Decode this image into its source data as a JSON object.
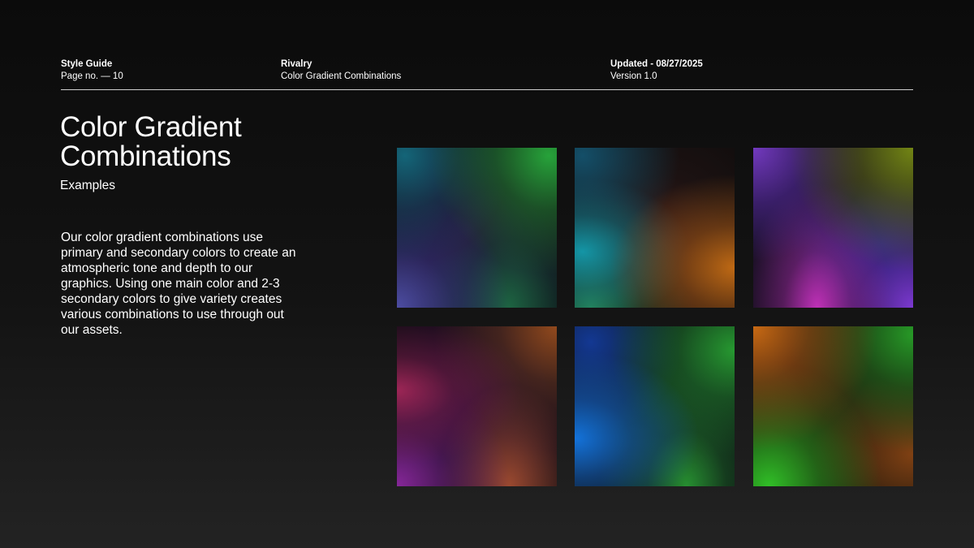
{
  "header": {
    "col1": {
      "title": "Style Guide",
      "sub": "Page no. — 10"
    },
    "col2": {
      "title": "Rivalry",
      "sub": "Color Gradient Combinations"
    },
    "col3": {
      "title": "Updated - 08/27/2025",
      "sub": "Version 1.0"
    }
  },
  "main": {
    "title": "Color Gradient Combinations",
    "subtitle": "Examples",
    "body": "Our color gradient combinations use primary and secondary colors to create an atmospheric tone and depth to our graphics. Using one main color and 2-3 secondary colors to give variety creates various combinations to use through out our assets."
  },
  "swatches": [
    {
      "colors": [
        "#1e6e82",
        "#28aa3c",
        "#5050aa",
        "#2a0f3e"
      ]
    },
    {
      "colors": [
        "#14a0b4",
        "#c86e14",
        "#28965a",
        "#3a1d1a"
      ]
    },
    {
      "colors": [
        "#783cc8",
        "#788c14",
        "#c832be",
        "#2a1740"
      ]
    },
    {
      "colors": [
        "#aa285a",
        "#a03c1e",
        "#8c28a0",
        "#2c0f36"
      ]
    },
    {
      "colors": [
        "#1478e6",
        "#28a032",
        "#145aa0",
        "#0f2a20"
      ]
    },
    {
      "colors": [
        "#d26e14",
        "#28a028",
        "#32c828",
        "#2e1c0c"
      ]
    }
  ]
}
